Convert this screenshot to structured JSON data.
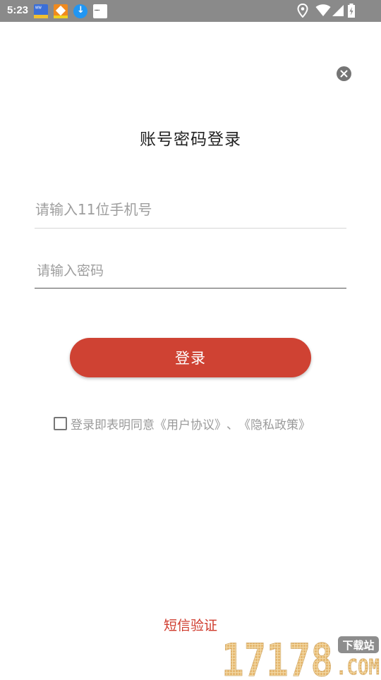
{
  "status_bar": {
    "time": "5:23",
    "notifications": [
      {
        "icon": "app-notification-icon-blue",
        "text": "",
        "color": "#3b6fd8"
      },
      {
        "icon": "app-notification-icon-orange",
        "text": "",
        "color": "#f08a1e"
      },
      {
        "icon": "download-icon",
        "text": "↓",
        "color": "#2196f3"
      },
      {
        "icon": "app-notification-icon-white",
        "text": "",
        "color": "#ffffff"
      }
    ],
    "system_icons": [
      "location-icon",
      "wifi-icon",
      "cell-signal-icon",
      "battery-charging-icon"
    ]
  },
  "close": {
    "icon": "close-icon"
  },
  "title": "账号密码登录",
  "phone_field": {
    "placeholder": "请输入11位手机号",
    "value": ""
  },
  "password_field": {
    "placeholder": "请输入密码",
    "value": ""
  },
  "login_button": {
    "label": "登录",
    "color": "#cf4233"
  },
  "agreement": {
    "checked": false,
    "prefix": "登录即表明同意",
    "user_agreement": "《用户协议》",
    "separator": "、",
    "privacy_policy": "《隐私政策》"
  },
  "sms_login": {
    "label": "短信验证",
    "color": "#cf3a2c"
  },
  "watermark": {
    "number": "17178",
    "badge": "下载站",
    "suffix": ".COM"
  }
}
